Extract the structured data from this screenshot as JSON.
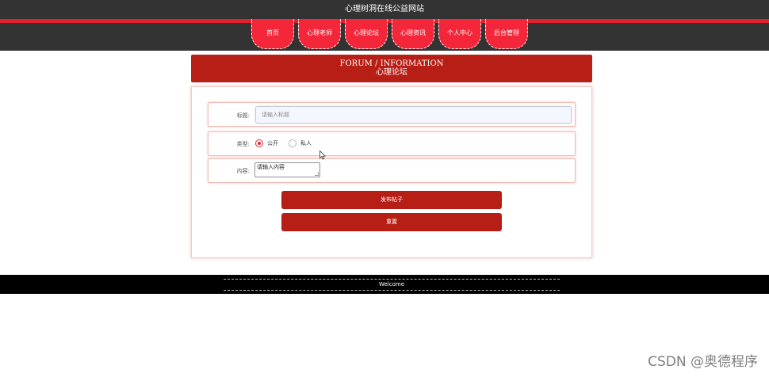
{
  "site": {
    "title": "心理树洞在线公益网站"
  },
  "nav": {
    "items": [
      {
        "label": "首页"
      },
      {
        "label": "心理老师"
      },
      {
        "label": "心理论坛"
      },
      {
        "label": "心理资讯"
      },
      {
        "label": "个人中心"
      },
      {
        "label": "后台管理"
      }
    ]
  },
  "panel": {
    "title_en": "FORUM / INFORMATION",
    "title_cn": "心理论坛"
  },
  "form": {
    "title_label": "标题:",
    "title_placeholder": "请输入标题",
    "type_label": "类型:",
    "type_options": [
      {
        "label": "公开",
        "checked": true
      },
      {
        "label": "私人",
        "checked": false
      }
    ],
    "content_label": "内容:",
    "content_value": "请输入内容",
    "submit_label": "发布帖子",
    "reset_label": "重置"
  },
  "footer": {
    "text": "Welcome"
  },
  "watermark": "CSDN @奥德程序",
  "colors": {
    "header_bg": "#333333",
    "accent_red": "#e2212b",
    "nav_tab": "#f3263a",
    "primary": "#b71f16",
    "footer_bg": "#000000"
  }
}
